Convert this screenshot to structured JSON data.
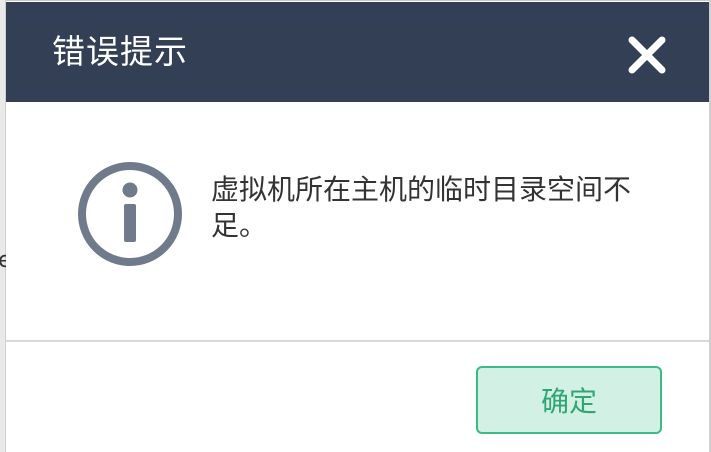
{
  "background_fragment": "e",
  "dialog": {
    "title": "错误提示",
    "close_icon": "close-icon",
    "info_icon": "info-circle-icon",
    "message": "虚拟机所在主机的临时目录空间不足。",
    "ok_label": "确定"
  },
  "colors": {
    "header_bg": "#333f55",
    "title_text": "#ffffff",
    "icon": "#6f7b8a",
    "button_bg": "#d3f0e4",
    "button_border": "#3dba84",
    "button_text": "#2fa774"
  }
}
